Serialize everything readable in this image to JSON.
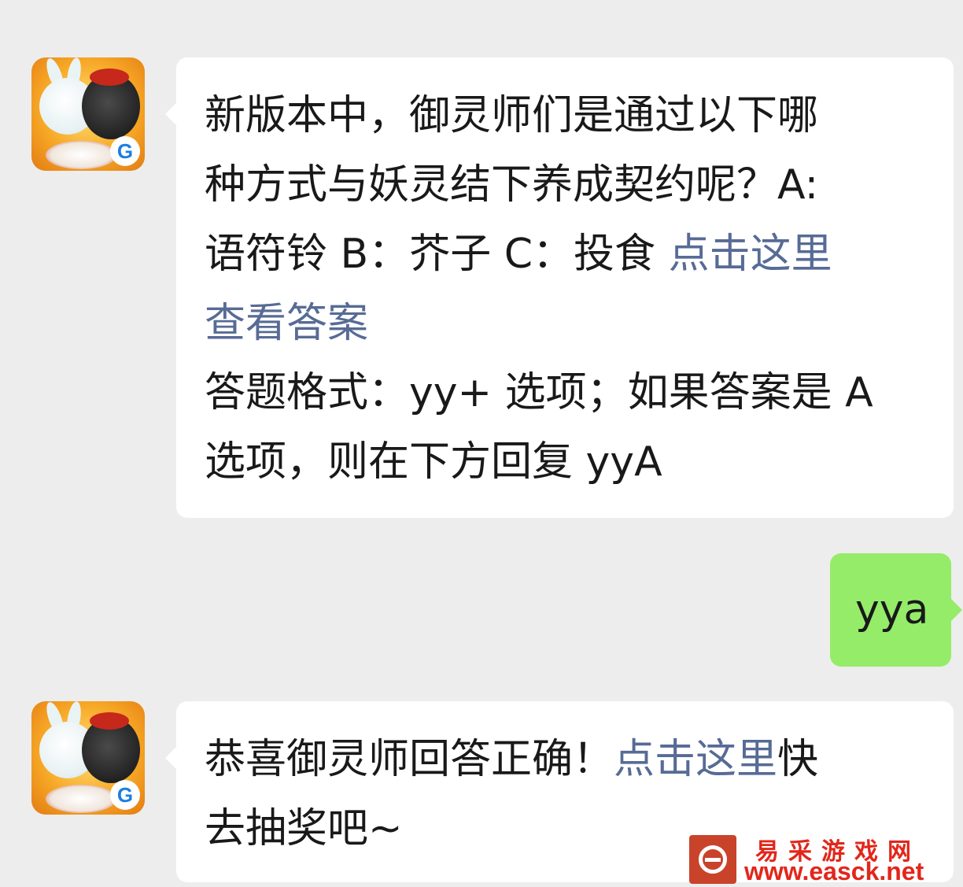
{
  "messages": [
    {
      "sender": "bot",
      "lines": [
        {
          "text": "新版本中，御灵师们是通过以下哪"
        },
        {
          "text": "种方式与妖灵结下养成契约呢？A:"
        },
        {
          "text": "语符铃 B：芥子 C：投食 ",
          "link": "点击这里"
        },
        {
          "link": "查看答案"
        },
        {
          "text": "答题格式：yy+ 选项；如果答案是 A"
        },
        {
          "text": "选项，则在下方回复 yyA"
        }
      ]
    },
    {
      "sender": "user",
      "text": "yya"
    },
    {
      "sender": "bot",
      "lines": [
        {
          "text": "恭喜御灵师回答正确！",
          "link": "点击这里",
          "after": "快"
        },
        {
          "text": "去抽奖吧~"
        }
      ]
    }
  ],
  "avatar": {
    "icon": "game-avatar-icon",
    "badge": "G"
  },
  "watermark": {
    "name": "易采游戏网",
    "url": "www.easck.net"
  },
  "colors": {
    "background": "#ededed",
    "bubble_in": "#ffffff",
    "bubble_out": "#95ec69",
    "link": "#576b95"
  }
}
